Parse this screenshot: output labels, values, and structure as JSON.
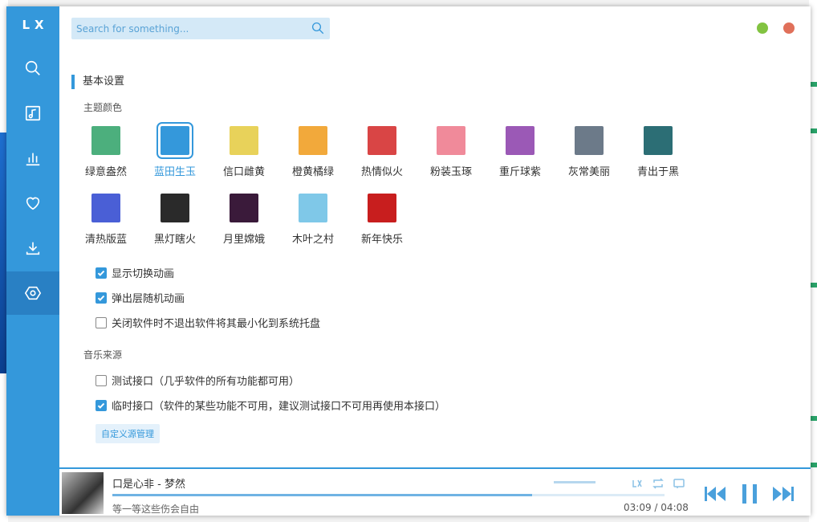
{
  "app": {
    "logo": "LX",
    "nav": [
      {
        "icon": "search-icon"
      },
      {
        "icon": "music-note-icon"
      },
      {
        "icon": "leaderboard-icon"
      },
      {
        "icon": "heart-icon"
      },
      {
        "icon": "download-icon"
      },
      {
        "icon": "settings-icon",
        "active": true
      }
    ],
    "search_placeholder": "Search for something...",
    "accent": "#3498db"
  },
  "settings": {
    "basic_title": "基本设置",
    "theme_color_title": "主题颜色",
    "themes": [
      {
        "label": "绿意盎然",
        "color": "#4caf7d"
      },
      {
        "label": "蓝田生玉",
        "color": "#3498db",
        "active": true
      },
      {
        "label": "信口雌黄",
        "color": "#e8d25a"
      },
      {
        "label": "橙黄橘绿",
        "color": "#f2a93b"
      },
      {
        "label": "热情似火",
        "color": "#d94545"
      },
      {
        "label": "粉装玉琢",
        "color": "#f08a9a"
      },
      {
        "label": "重斤球紫",
        "color": "#9b59b6"
      },
      {
        "label": "灰常美丽",
        "color": "#6c7a89"
      },
      {
        "label": "青出于黑",
        "color": "#2c6e75"
      },
      {
        "label": "清热版蓝",
        "color": "#4a5fd6"
      },
      {
        "label": "黑灯瞎火",
        "color": "#2a2a2a"
      },
      {
        "label": "月里嫦娥",
        "color": "#3a1a3a"
      },
      {
        "label": "木叶之村",
        "color": "#7fc8e8"
      },
      {
        "label": "新年快乐",
        "color": "#c81e1e"
      }
    ],
    "options": [
      {
        "label": "显示切换动画",
        "checked": true
      },
      {
        "label": "弹出层随机动画",
        "checked": true
      },
      {
        "label": "关闭软件时不退出软件将其最小化到系统托盘",
        "checked": false
      }
    ],
    "music_source_title": "音乐来源",
    "sources": [
      {
        "label": "测试接口（几乎软件的所有功能都可用）",
        "checked": false
      },
      {
        "label": "临时接口（软件的某些功能不可用，建议测试接口不可用再使用本接口）",
        "checked": true
      }
    ],
    "custom_source_button": "自定义源管理"
  },
  "player": {
    "song": "口是心非 - 梦然",
    "lyric": "等一等这些伤会自由",
    "current_time": "03:09",
    "separator": "/",
    "total_time": "04:08",
    "progress": 0.76,
    "volume": 1.0
  }
}
